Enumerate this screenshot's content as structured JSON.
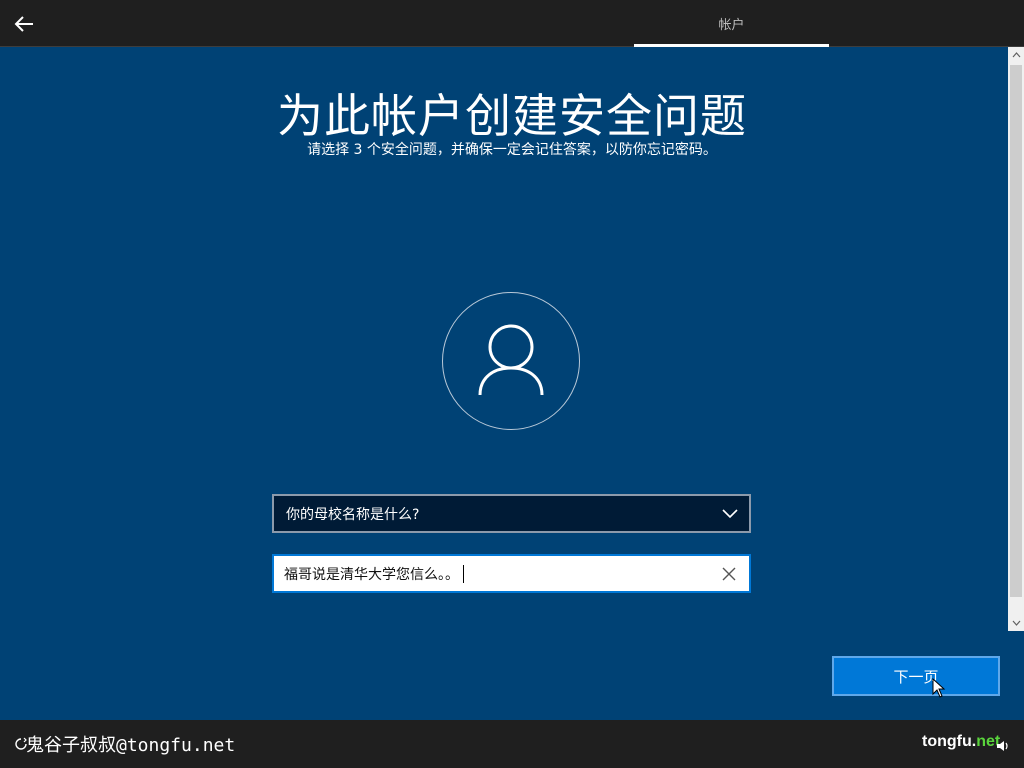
{
  "header": {
    "tab_label": "帐户"
  },
  "page": {
    "title": "为此帐户创建安全问题",
    "subtitle": "请选择 3 个安全问题，并确保一定会记住答案，以防你忘记密码。"
  },
  "form": {
    "question_selected": "你的母校名称是什么?",
    "answer_value": "福哥说是清华大学您信么。。"
  },
  "actions": {
    "next_label": "下一页"
  },
  "footer": {
    "watermark_left": "鬼谷子叔叔@tongfu.net",
    "watermark_right_part1": "tongfu.",
    "watermark_right_part2": "net"
  },
  "icons": {
    "back": "back-arrow-icon",
    "avatar": "user-avatar-icon",
    "dropdown": "chevron-down-icon",
    "clear": "close-icon",
    "ease_of_access": "ease-of-access-icon",
    "volume": "volume-icon"
  },
  "colors": {
    "background": "#004275",
    "topbar": "#1f1f1f",
    "accent": "#0078d7",
    "select_bg": "#001b36"
  }
}
